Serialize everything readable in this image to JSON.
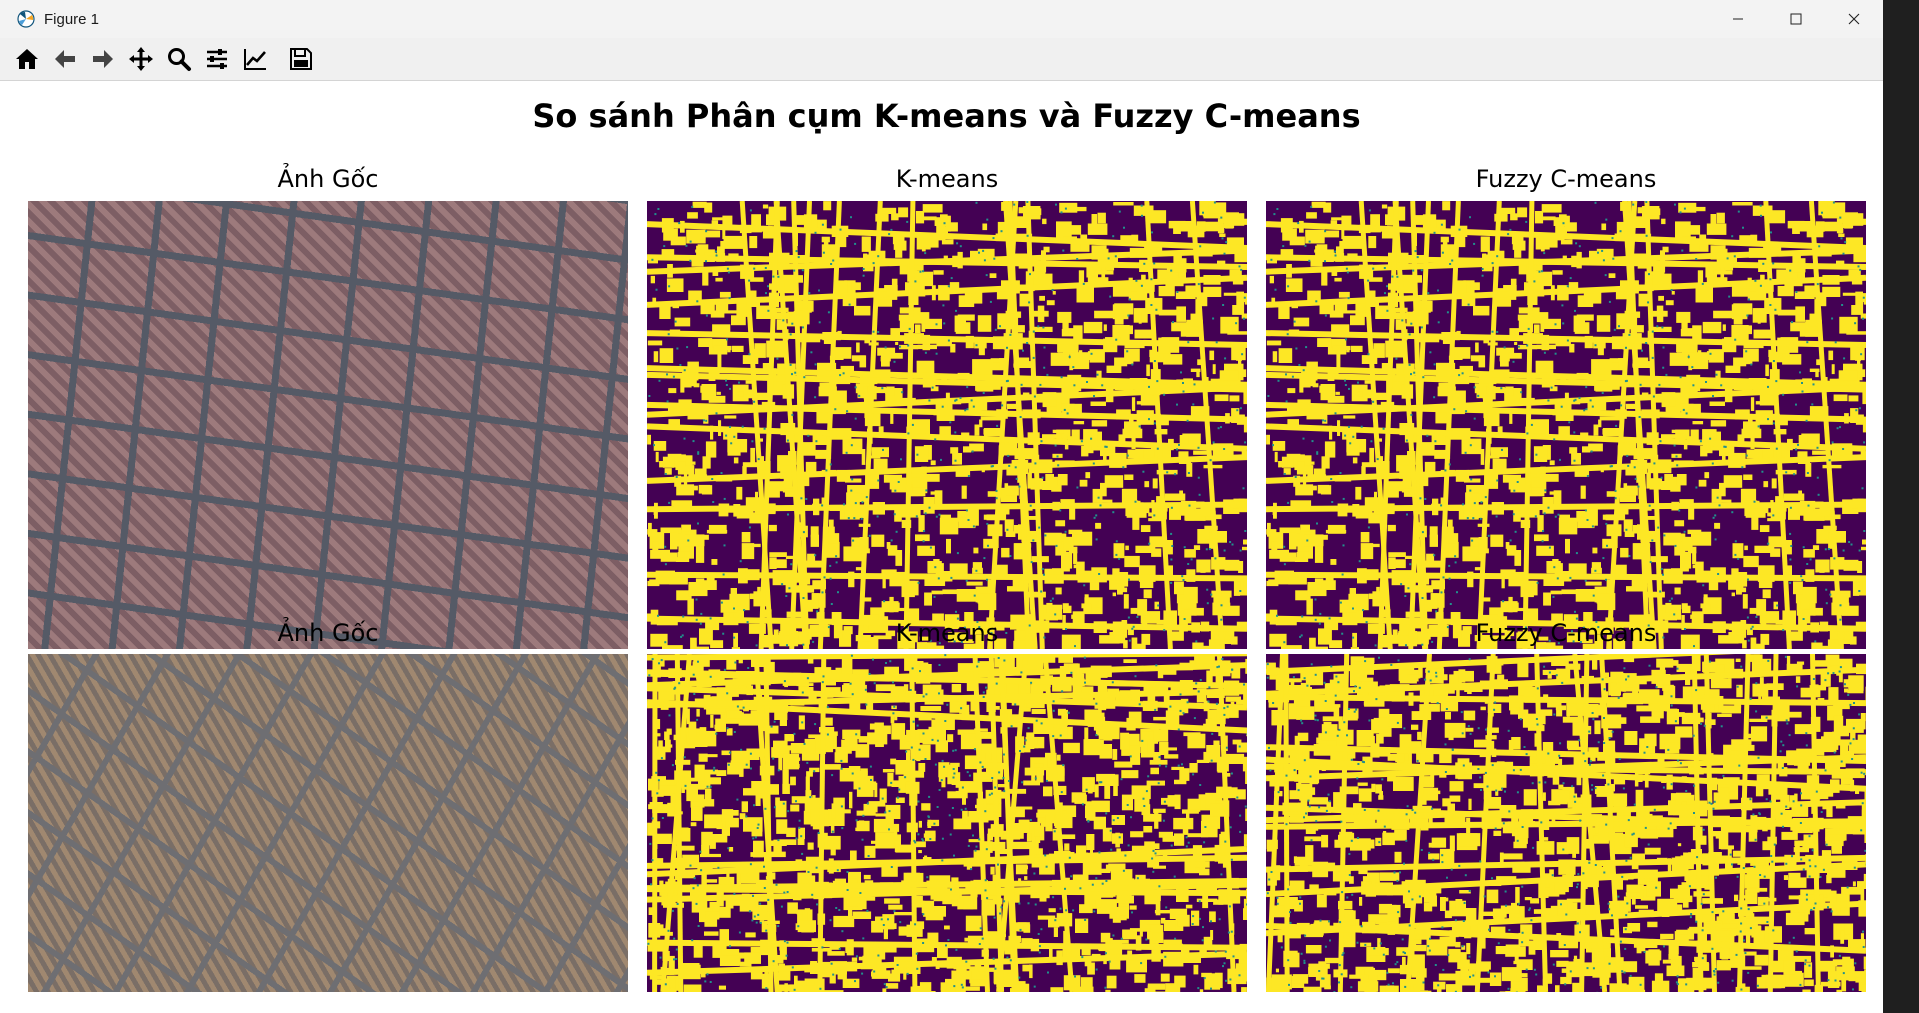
{
  "window": {
    "title": "Figure 1"
  },
  "toolbar": {
    "icons": [
      "home-icon",
      "back-icon",
      "forward-icon",
      "pan-icon",
      "zoom-icon",
      "configure-subplots-icon",
      "edit-axis-icon",
      "save-icon"
    ]
  },
  "figure": {
    "suptitle": "So sánh Phân cụm K-means và Fuzzy C-means",
    "rows": [
      {
        "original": "Ảnh Gốc",
        "kmeans": "K-means",
        "fuzzy": "Fuzzy C-means"
      },
      {
        "original": "Ảnh Gốc",
        "kmeans": "K-means",
        "fuzzy": "Fuzzy C-means"
      }
    ]
  },
  "colors": {
    "cluster_dark": "#440154",
    "cluster_light": "#fde725",
    "cluster_edge": "#21918c"
  }
}
